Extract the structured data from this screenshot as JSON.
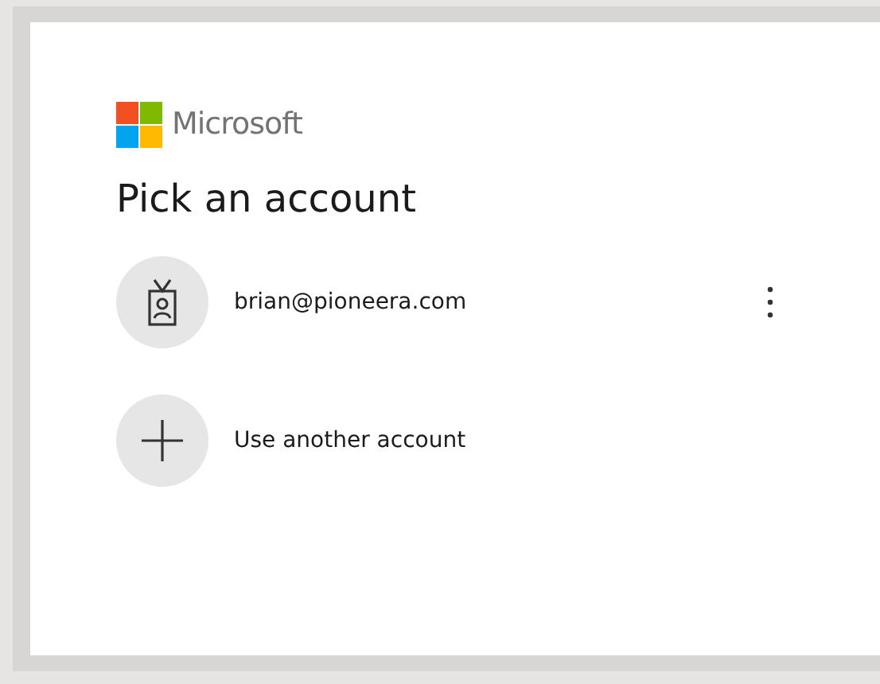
{
  "brand": {
    "name": "Microsoft"
  },
  "title": "Pick an account",
  "accounts": [
    {
      "kind": "account",
      "label": "brian@pioneera.com"
    },
    {
      "kind": "add",
      "label": "Use another account"
    }
  ]
}
